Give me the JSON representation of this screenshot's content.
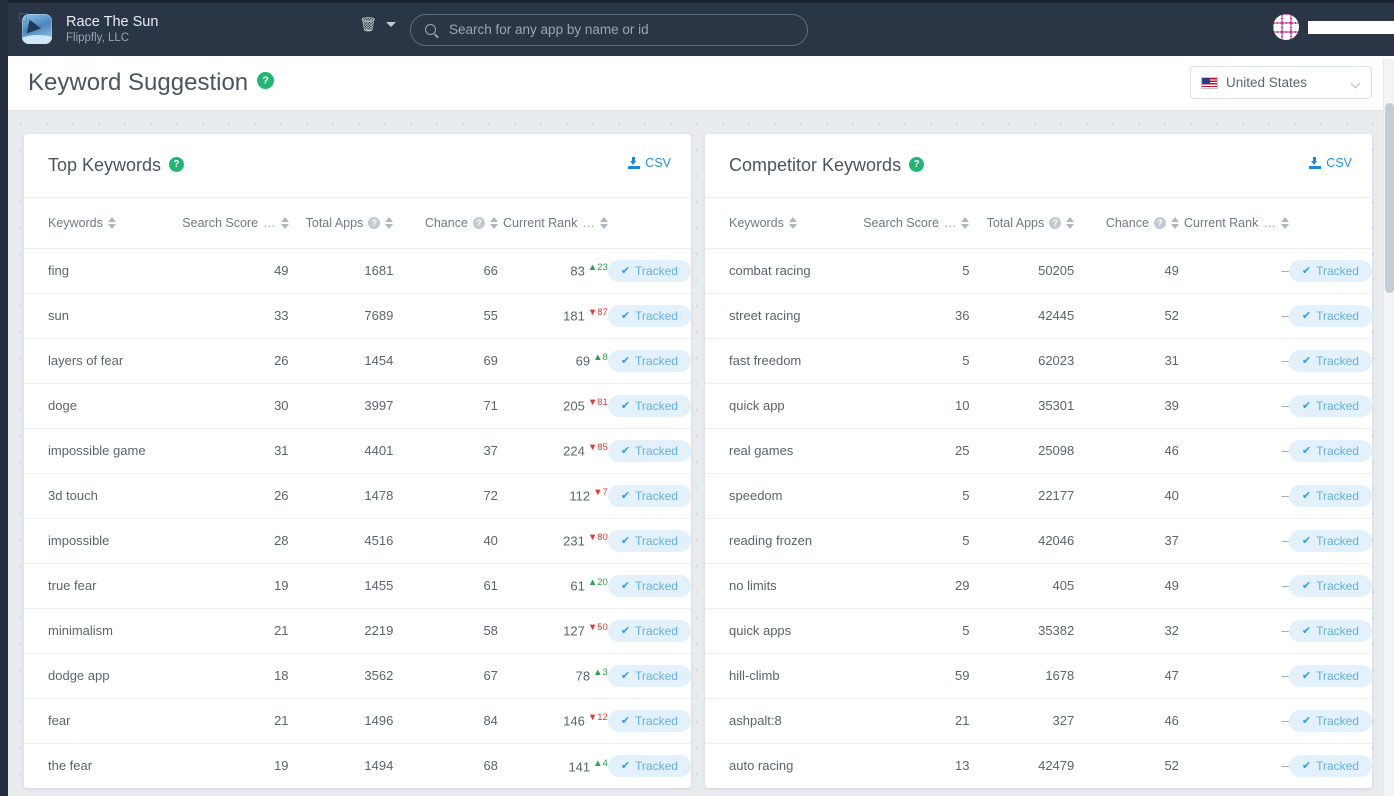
{
  "topbar": {
    "app_name": "Race The Sun",
    "app_publisher": "Flippfly, LLC",
    "app_icon": "app-thumbnail-icon",
    "platform_icon": "apple-icon",
    "delete_icon": "trash-icon",
    "dropdown_icon": "chevron-down-icon",
    "search": {
      "placeholder": "Search for any app by name or id",
      "value": "",
      "icon": "search-icon"
    },
    "avatar": "user-avatar",
    "account_name": ""
  },
  "header": {
    "title": "Keyword Suggestion",
    "help_badge": "?",
    "country": {
      "label": "United States",
      "flag": "us-flag-icon",
      "chevron": "chevron-down-icon"
    }
  },
  "colors": {
    "topbar_bg": "#2a3646",
    "rail_bg": "#232f3e",
    "page_bg": "#e8ecef",
    "accent_blue": "#2a8fe0",
    "help_green": "#22b573",
    "delta_up": "#2f9e4f",
    "delta_down": "#e23a3a",
    "tracked_bg": "#e2f1fc",
    "tracked_fg": "#64afe6"
  },
  "columns": [
    {
      "label": "Keywords",
      "hint": false
    },
    {
      "label": "Search Score",
      "truncated": true,
      "hint": false
    },
    {
      "label": "Total Apps",
      "hint": true
    },
    {
      "label": "Chance",
      "hint": true
    },
    {
      "label": "Current Rank",
      "truncated": true,
      "hint": false
    },
    {
      "label": "",
      "hint": false
    }
  ],
  "panels": [
    {
      "id": "top-keywords",
      "title": "Top Keywords",
      "help_badge": "?",
      "csv_label": "CSV",
      "csv_icon": "download-icon",
      "rows": [
        {
          "keyword": "fing",
          "search_score": "49",
          "total_apps": "1681",
          "chance": "66",
          "current_rank": "83",
          "delta": "23",
          "delta_dir": "up",
          "action": "Tracked"
        },
        {
          "keyword": "sun",
          "search_score": "33",
          "total_apps": "7689",
          "chance": "55",
          "current_rank": "181",
          "delta": "87",
          "delta_dir": "down",
          "action": "Tracked"
        },
        {
          "keyword": "layers of fear",
          "search_score": "26",
          "total_apps": "1454",
          "chance": "69",
          "current_rank": "69",
          "delta": "8",
          "delta_dir": "up",
          "action": "Tracked"
        },
        {
          "keyword": "doge",
          "search_score": "30",
          "total_apps": "3997",
          "chance": "71",
          "current_rank": "205",
          "delta": "81",
          "delta_dir": "down",
          "action": "Tracked"
        },
        {
          "keyword": "impossible game",
          "search_score": "31",
          "total_apps": "4401",
          "chance": "37",
          "current_rank": "224",
          "delta": "85",
          "delta_dir": "down",
          "action": "Tracked"
        },
        {
          "keyword": "3d touch",
          "search_score": "26",
          "total_apps": "1478",
          "chance": "72",
          "current_rank": "112",
          "delta": "7",
          "delta_dir": "down",
          "action": "Tracked"
        },
        {
          "keyword": "impossible",
          "search_score": "28",
          "total_apps": "4516",
          "chance": "40",
          "current_rank": "231",
          "delta": "80",
          "delta_dir": "down",
          "action": "Tracked"
        },
        {
          "keyword": "true fear",
          "search_score": "19",
          "total_apps": "1455",
          "chance": "61",
          "current_rank": "61",
          "delta": "20",
          "delta_dir": "up",
          "action": "Tracked"
        },
        {
          "keyword": "minimalism",
          "search_score": "21",
          "total_apps": "2219",
          "chance": "58",
          "current_rank": "127",
          "delta": "50",
          "delta_dir": "down",
          "action": "Tracked"
        },
        {
          "keyword": "dodge app",
          "search_score": "18",
          "total_apps": "3562",
          "chance": "67",
          "current_rank": "78",
          "delta": "3",
          "delta_dir": "up",
          "action": "Tracked"
        },
        {
          "keyword": "fear",
          "search_score": "21",
          "total_apps": "1496",
          "chance": "84",
          "current_rank": "146",
          "delta": "12",
          "delta_dir": "down",
          "action": "Tracked"
        },
        {
          "keyword": "the fear",
          "search_score": "19",
          "total_apps": "1494",
          "chance": "68",
          "current_rank": "141",
          "delta": "4",
          "delta_dir": "up",
          "action": "Tracked"
        }
      ]
    },
    {
      "id": "competitor-keywords",
      "title": "Competitor Keywords",
      "help_badge": "?",
      "csv_label": "CSV",
      "csv_icon": "download-icon",
      "rows": [
        {
          "keyword": "combat racing",
          "search_score": "5",
          "total_apps": "50205",
          "chance": "49",
          "current_rank": "–",
          "delta": "",
          "delta_dir": "",
          "action": "Tracked"
        },
        {
          "keyword": "street racing",
          "search_score": "36",
          "total_apps": "42445",
          "chance": "52",
          "current_rank": "–",
          "delta": "",
          "delta_dir": "",
          "action": "Tracked"
        },
        {
          "keyword": "fast freedom",
          "search_score": "5",
          "total_apps": "62023",
          "chance": "31",
          "current_rank": "–",
          "delta": "",
          "delta_dir": "",
          "action": "Tracked"
        },
        {
          "keyword": "quick app",
          "search_score": "10",
          "total_apps": "35301",
          "chance": "39",
          "current_rank": "–",
          "delta": "",
          "delta_dir": "",
          "action": "Tracked"
        },
        {
          "keyword": "real games",
          "search_score": "25",
          "total_apps": "25098",
          "chance": "46",
          "current_rank": "–",
          "delta": "",
          "delta_dir": "",
          "action": "Tracked"
        },
        {
          "keyword": "speedom",
          "search_score": "5",
          "total_apps": "22177",
          "chance": "40",
          "current_rank": "–",
          "delta": "",
          "delta_dir": "",
          "action": "Tracked"
        },
        {
          "keyword": "reading frozen",
          "search_score": "5",
          "total_apps": "42046",
          "chance": "37",
          "current_rank": "–",
          "delta": "",
          "delta_dir": "",
          "action": "Tracked"
        },
        {
          "keyword": "no limits",
          "search_score": "29",
          "total_apps": "405",
          "chance": "49",
          "current_rank": "–",
          "delta": "",
          "delta_dir": "",
          "action": "Tracked"
        },
        {
          "keyword": "quick apps",
          "search_score": "5",
          "total_apps": "35382",
          "chance": "32",
          "current_rank": "–",
          "delta": "",
          "delta_dir": "",
          "action": "Tracked"
        },
        {
          "keyword": "hill-climb",
          "search_score": "59",
          "total_apps": "1678",
          "chance": "47",
          "current_rank": "–",
          "delta": "",
          "delta_dir": "",
          "action": "Tracked"
        },
        {
          "keyword": "ashpalt:8",
          "search_score": "21",
          "total_apps": "327",
          "chance": "46",
          "current_rank": "–",
          "delta": "",
          "delta_dir": "",
          "action": "Tracked"
        },
        {
          "keyword": "auto racing",
          "search_score": "13",
          "total_apps": "42479",
          "chance": "52",
          "current_rank": "–",
          "delta": "",
          "delta_dir": "",
          "action": "Tracked"
        }
      ]
    }
  ]
}
